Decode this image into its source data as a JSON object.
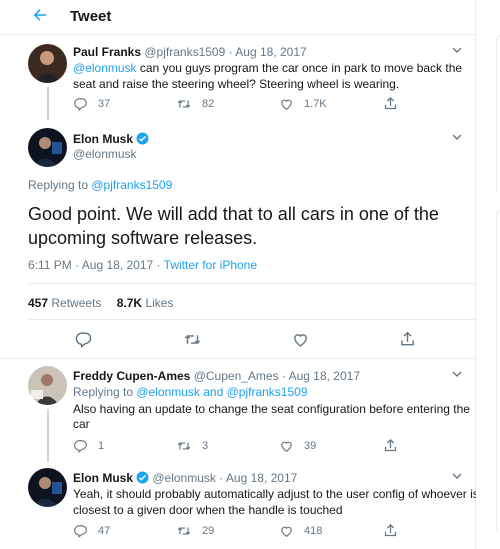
{
  "header": {
    "title": "Tweet"
  },
  "parent_tweet": {
    "name": "Paul Franks",
    "handle": "@pjfranks1509",
    "date": "Aug 18, 2017",
    "mention": "@elonmusk",
    "text_line1": " can you guys program the car once in park to move back the",
    "text_line2": "seat and raise the steering wheel? Steering wheel is wearing.",
    "replies": "37",
    "retweets": "82",
    "likes": "1.7K"
  },
  "main_tweet": {
    "name": "Elon Musk",
    "handle": "@elonmusk",
    "replying_prefix": "Replying to ",
    "replying_to": "@pjfranks1509",
    "text_line1": "Good point. We will add that to all cars in one of the",
    "text_line2": "upcoming software releases.",
    "time": "6:11 PM · Aug 18, 2017 · ",
    "source": "Twitter for iPhone",
    "retweet_count": "457",
    "retweet_label": "Retweets",
    "like_count": "8.7K",
    "like_label": "Likes"
  },
  "reply1": {
    "name": "Freddy Cupen-Ames",
    "handle": "@Cupen_Ames",
    "date": "Aug 18, 2017",
    "replying_prefix": "Replying to ",
    "replying_to": "@elonmusk and @pjfranks1509",
    "text_line1": "Also having an update to change the seat configuration before entering the",
    "text_line2": "car",
    "replies": "1",
    "retweets": "3",
    "likes": "39"
  },
  "reply2": {
    "name": "Elon Musk",
    "handle": "@elonmusk",
    "date": "Aug 18, 2017",
    "text_line1": "Yeah, it should probably automatically adjust to the user config of whoever is",
    "text_line2": "closest to a given door when the handle is touched",
    "replies": "47",
    "retweets": "29",
    "likes": "418"
  },
  "icons": [
    "back-arrow-icon",
    "chevron-down-icon",
    "reply-icon",
    "retweet-icon",
    "like-icon",
    "share-icon",
    "verified-badge-icon"
  ],
  "colors": {
    "accent": "#1da1f2",
    "muted": "#657786",
    "text": "#14171a",
    "border": "#e6ecf0"
  }
}
